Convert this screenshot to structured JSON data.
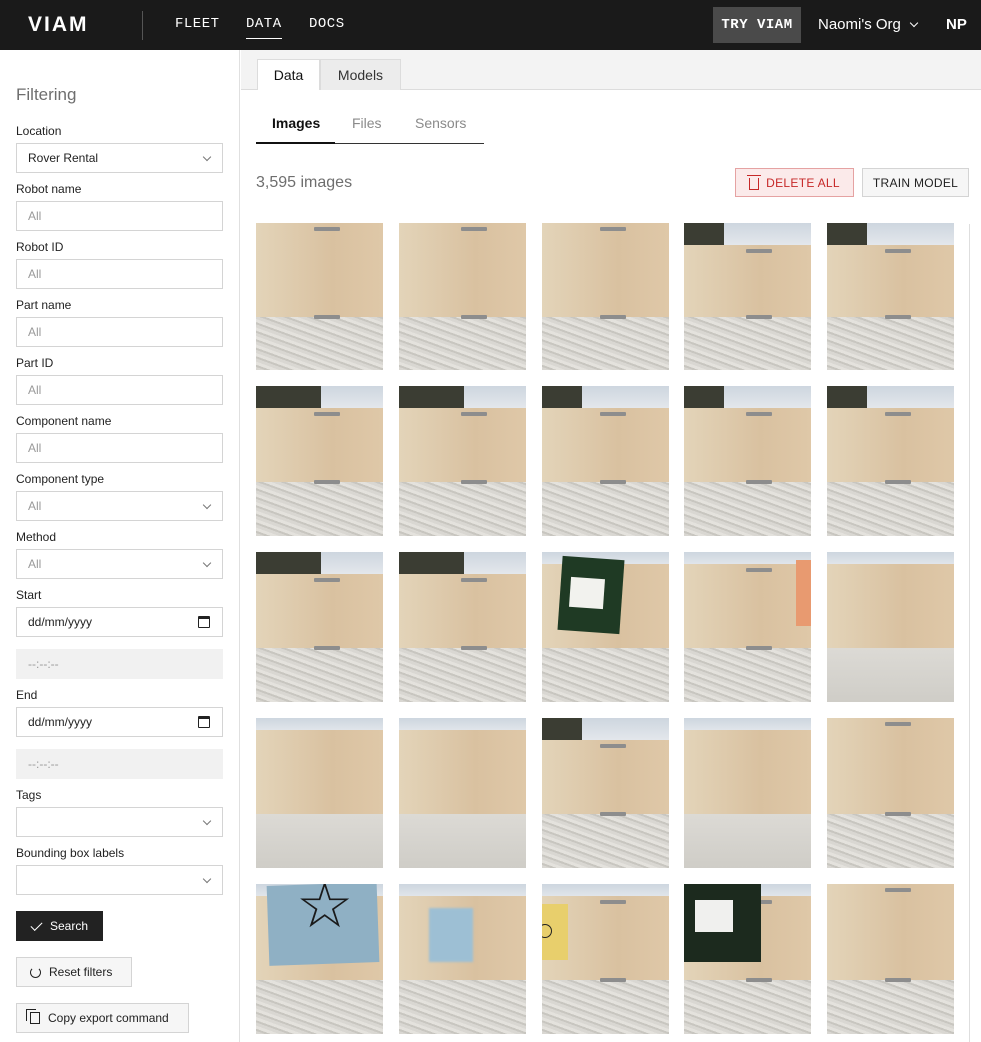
{
  "topnav": {
    "logo": "VIAM",
    "items": [
      "FLEET",
      "DATA",
      "DOCS"
    ],
    "try_label": "TRY VIAM",
    "org_name": "Naomi's Org",
    "avatar_initials": "NP"
  },
  "sidebar": {
    "title": "Filtering",
    "location_label": "Location",
    "location_value": "Rover Rental",
    "robot_name_label": "Robot name",
    "robot_name_placeholder": "All",
    "robot_id_label": "Robot ID",
    "robot_id_placeholder": "All",
    "part_name_label": "Part name",
    "part_name_placeholder": "All",
    "part_id_label": "Part ID",
    "part_id_placeholder": "All",
    "component_name_label": "Component name",
    "component_name_placeholder": "All",
    "component_type_label": "Component type",
    "component_type_value": "All",
    "method_label": "Method",
    "method_value": "All",
    "start_label": "Start",
    "start_date": "dd/mm/yyyy",
    "start_time": "--:--:--",
    "end_label": "End",
    "end_date": "dd/mm/yyyy",
    "end_time": "--:--:--",
    "tags_label": "Tags",
    "bbox_label": "Bounding box labels",
    "search_label": "Search",
    "reset_label": "Reset filters",
    "copy_label": "Copy export command"
  },
  "main": {
    "page_tabs": [
      "Data",
      "Models"
    ],
    "sub_tabs": [
      "Images",
      "Files",
      "Sensors"
    ],
    "image_count": "3,595 images",
    "delete_label": "DELETE ALL",
    "train_label": "TRAIN MODEL"
  },
  "colors": {
    "topbar": "#1a1a1a",
    "delete_accent": "#c62828",
    "search_button": "#222222"
  }
}
